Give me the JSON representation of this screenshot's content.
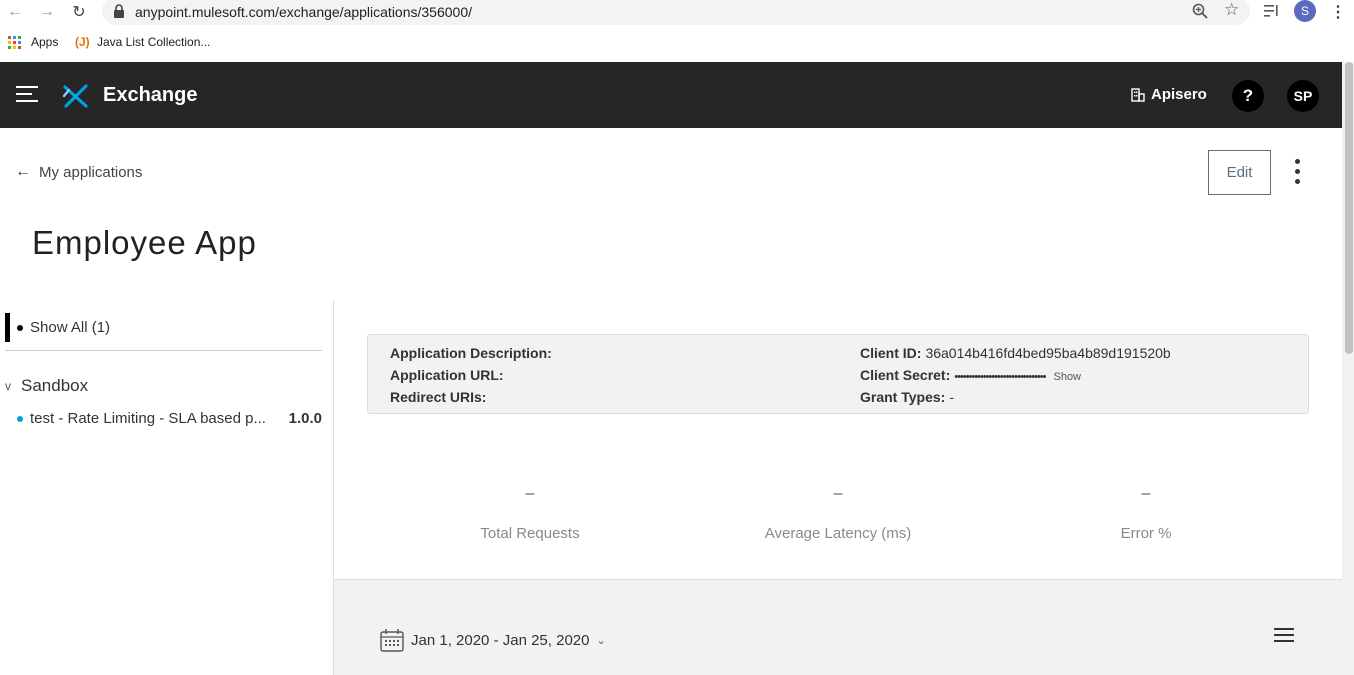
{
  "browser": {
    "url": "anypoint.mulesoft.com/exchange/applications/356000/",
    "profile_initial": "S",
    "bookmarks": [
      {
        "label": "Apps"
      },
      {
        "label": "Java List Collection..."
      }
    ]
  },
  "header": {
    "brand": "Exchange",
    "org_name": "Apisero",
    "help_label": "?",
    "user_initials": "SP",
    "background": "#262626"
  },
  "page": {
    "back_label": "My applications",
    "edit_label": "Edit",
    "title": "Employee App"
  },
  "sidebar": {
    "show_all_label": "Show All (1)",
    "environment": "Sandbox",
    "contracts": [
      {
        "name": "test - Rate Limiting - SLA based p...",
        "version": "1.0.0",
        "dot_color": "#00a2df"
      }
    ]
  },
  "details": {
    "description_label": "Application Description:",
    "url_label": "Application URL:",
    "redirect_label": "Redirect URIs:",
    "client_id_label": "Client ID:",
    "client_id_value": "36a014b416fd4bed95ba4b89d191520b",
    "client_secret_label": "Client Secret:",
    "client_secret_value": "••••••••••••••••••••••••••••••••",
    "show_label": "Show",
    "grant_types_label": "Grant Types:",
    "grant_types_value": "-"
  },
  "stats": [
    {
      "value": "–",
      "label": "Total Requests"
    },
    {
      "value": "–",
      "label": "Average Latency (ms)"
    },
    {
      "value": "–",
      "label": "Error %"
    }
  ],
  "analytics": {
    "date_range": "Jan 1, 2020 - Jan 25, 2020"
  },
  "icons": [
    "back-arrow-icon",
    "forward-arrow-icon",
    "reload-icon",
    "lock-icon",
    "zoom-icon",
    "star-icon",
    "reading-list-icon",
    "more-vert-icon",
    "apps-grid-icon",
    "hamburger-icon",
    "exchange-logo-icon",
    "building-icon",
    "arrow-left-icon",
    "kebab-icon",
    "calendar-icon",
    "chevron-down-icon",
    "list-menu-icon"
  ]
}
